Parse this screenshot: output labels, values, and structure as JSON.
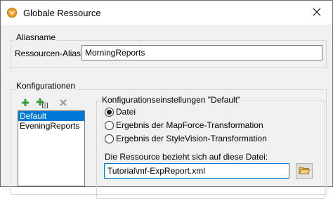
{
  "window": {
    "title": "Globale Ressource"
  },
  "icons": {
    "app": "altova-resource-icon",
    "close": "close-icon",
    "add": "add-icon",
    "add_copy": "add-copy-icon",
    "delete": "delete-icon",
    "browse": "open-folder-icon"
  },
  "alias_section": {
    "legend": "Aliasname",
    "label": "Ressourcen-Alias:",
    "value": "MorningReports"
  },
  "config_section": {
    "legend": "Konfigurationen",
    "items": [
      {
        "label": "Default",
        "selected": true
      },
      {
        "label": "EveningReports",
        "selected": false
      }
    ]
  },
  "settings": {
    "legend": "Konfigurationseinstellungen \"Default\"",
    "options": [
      {
        "label": "Datei",
        "checked": true
      },
      {
        "label": "Ergebnis der MapForce-Transformation",
        "checked": false
      },
      {
        "label": "Ergebnis der StyleVision-Transformation",
        "checked": false
      }
    ],
    "file_label": "Die Ressource bezieht sich auf diese Datei:",
    "file_value": "Tutorial\\mf-ExpReport.xml"
  },
  "colors": {
    "selection": "#0078d7",
    "add_green": "#2e9e2e",
    "app_icon_orange": "#f0a020"
  }
}
